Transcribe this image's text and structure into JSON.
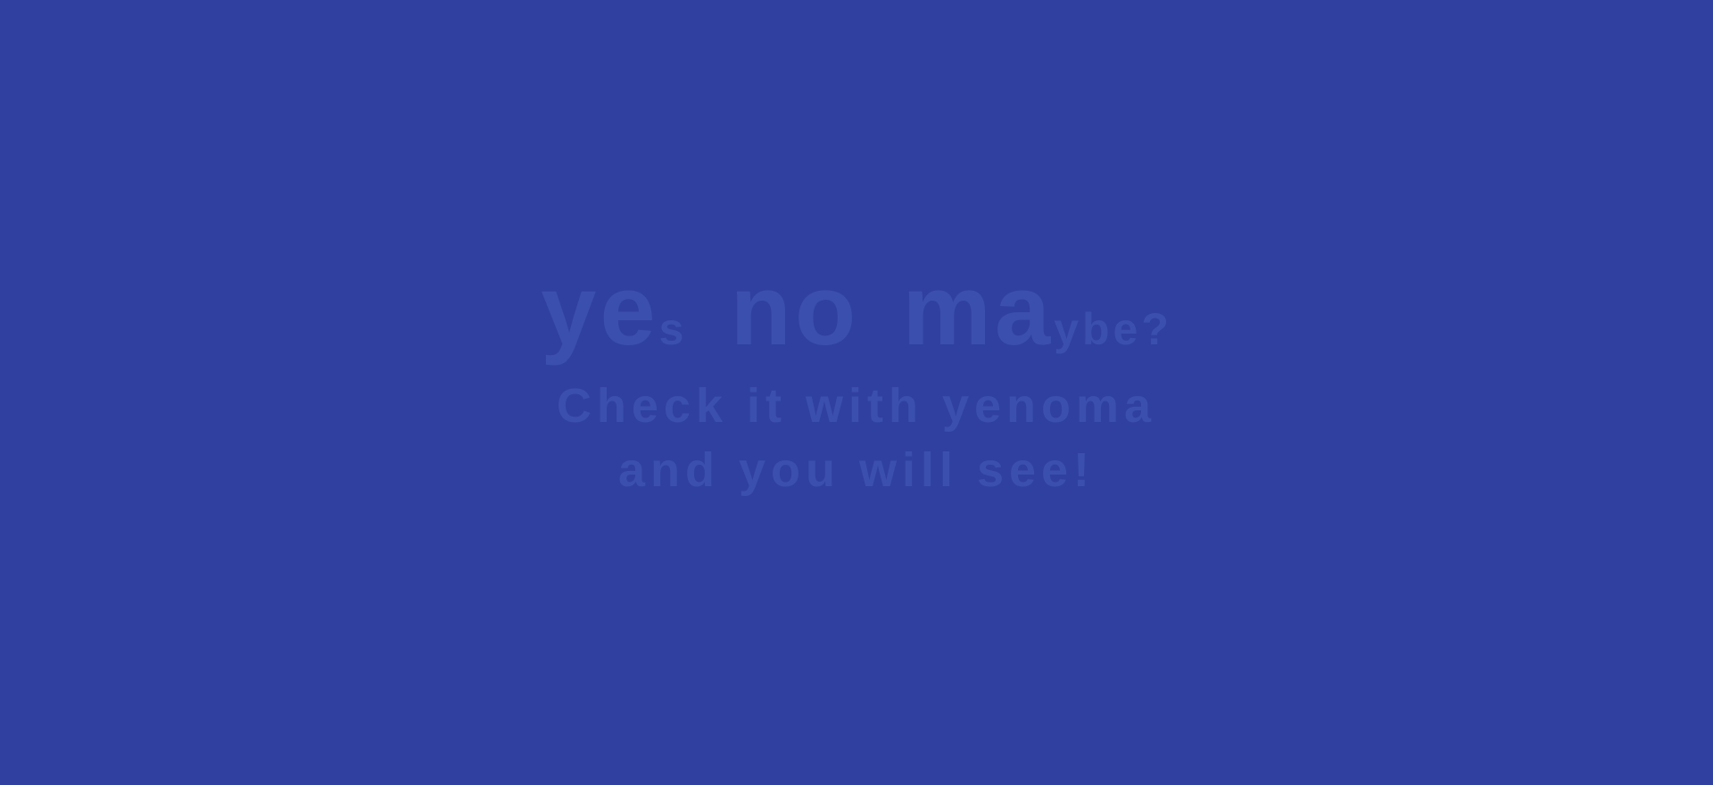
{
  "headline": {
    "ye": "ye",
    "s": "s",
    "no": "no",
    "ma": "ma",
    "ybe": "ybe?"
  },
  "tagline": {
    "line1": "Check it with yenoma",
    "line2": "and you will see!"
  },
  "colors": {
    "background": "#3040a0",
    "text": "#3b4fae"
  }
}
